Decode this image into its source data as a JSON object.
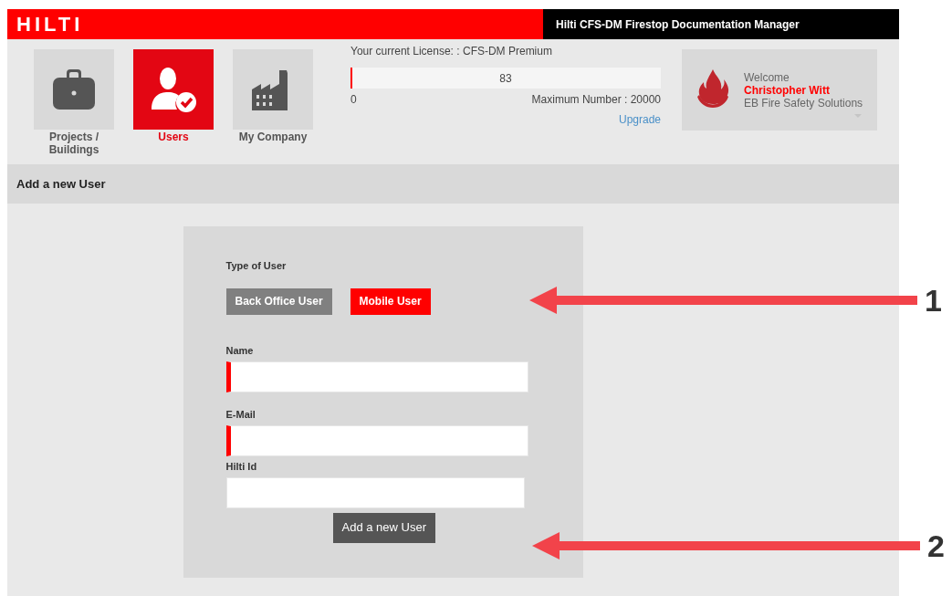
{
  "top_bar": {
    "logo": "HILTI",
    "app_title": "Hilti CFS-DM Firestop Documentation Manager"
  },
  "nav": [
    {
      "label": "Projects / Buildings",
      "kind": "briefcase",
      "selected": false
    },
    {
      "label": "Users",
      "kind": "user",
      "selected": true
    },
    {
      "label": "My Company",
      "kind": "factory",
      "selected": false
    }
  ],
  "license": {
    "label": "Your current License: : CFS-DM Premium",
    "count": "83",
    "level": 0.00415,
    "min": "0",
    "max": "Maximum Number : 20000",
    "upgrade_link": "Upgrade"
  },
  "user_card": {
    "greeting": "Welcome",
    "name": "Christopher Witt",
    "company": "EB Fire Safety Solutions"
  },
  "section_title": "Add a new User",
  "form": {
    "type_label": "Type of User",
    "user_types": [
      {
        "label": "Back Office User",
        "selected": false
      },
      {
        "label": "Mobile User",
        "selected": true
      }
    ],
    "fields": [
      {
        "label": "Name",
        "required": true
      },
      {
        "label": "E-Mail",
        "required": true
      },
      {
        "label": "Hilti Id",
        "required": false
      }
    ],
    "submit": "Add a new User"
  },
  "annotations": [
    {
      "number": "1"
    },
    {
      "number": "2"
    }
  ]
}
